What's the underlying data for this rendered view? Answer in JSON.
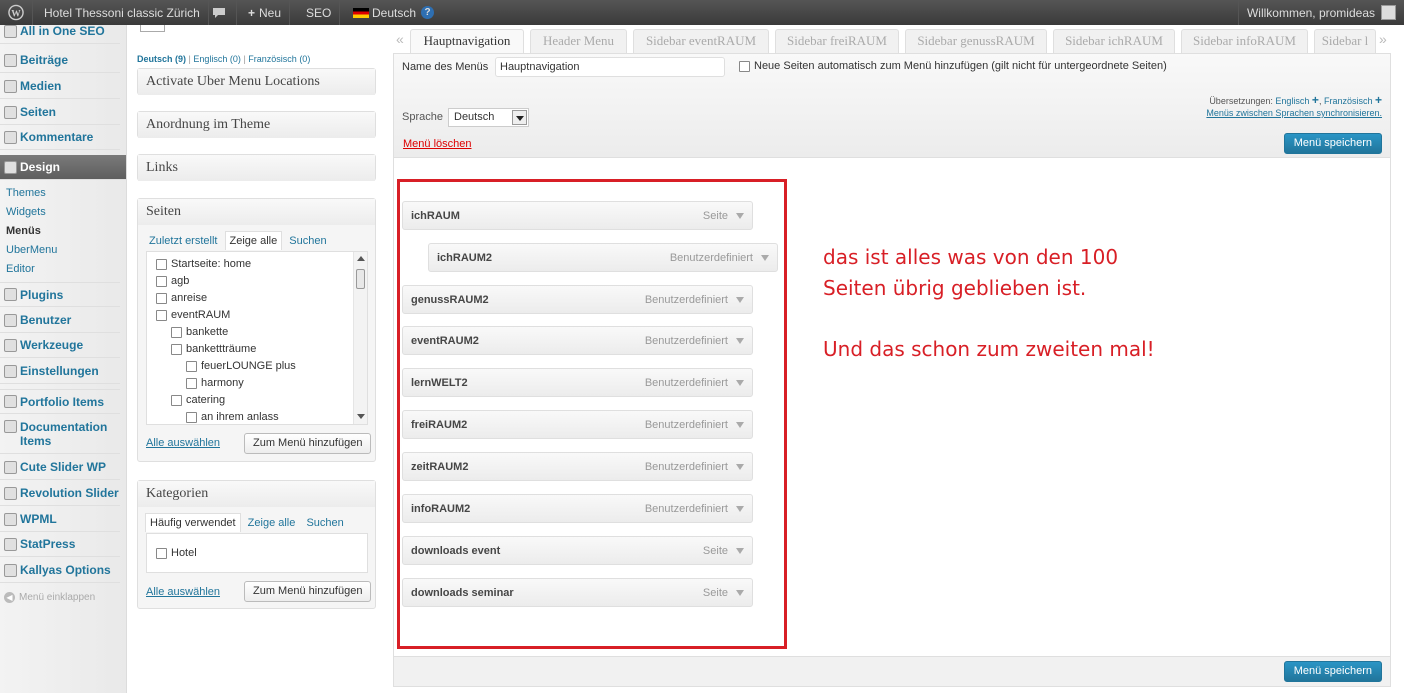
{
  "admin_bar": {
    "site_title": "Hotel Thessoni classic Zürich",
    "new_label": "Neu",
    "seo_label": "SEO",
    "language": "Deutsch",
    "help": "?",
    "welcome": "Willkommen, promideas"
  },
  "sidebar": {
    "items": [
      {
        "label": "All in One SEO"
      },
      {
        "label": "Beiträge"
      },
      {
        "label": "Medien"
      },
      {
        "label": "Seiten"
      },
      {
        "label": "Kommentare"
      },
      {
        "label": "Design"
      },
      {
        "label": "Plugins"
      },
      {
        "label": "Benutzer"
      },
      {
        "label": "Werkzeuge"
      },
      {
        "label": "Einstellungen"
      },
      {
        "label": "Portfolio Items"
      },
      {
        "label": "Documentation Items"
      },
      {
        "label": "Cute Slider WP"
      },
      {
        "label": "Revolution Slider"
      },
      {
        "label": "WPML"
      },
      {
        "label": "StatPress"
      },
      {
        "label": "Kallyas Options"
      }
    ],
    "design_sub": [
      "Themes",
      "Widgets",
      "Menüs",
      "UberMenu",
      "Editor"
    ],
    "collapse": "Menü einklappen"
  },
  "languages": {
    "de": "Deutsch (9)",
    "sep": "|",
    "en": "Englisch (0)",
    "fr": "Französisch (0)"
  },
  "boxes": {
    "uber": "Activate Uber Menu Locations",
    "anordnung": "Anordnung im Theme",
    "links": "Links",
    "seiten": {
      "title": "Seiten",
      "tabs": [
        "Zuletzt erstellt",
        "Zeige alle",
        "Suchen"
      ],
      "items": [
        "Startseite: home",
        "agb",
        "anreise",
        "eventRAUM",
        "bankette",
        "bankettträume",
        "feuerLOUNGE plus",
        "harmony",
        "catering",
        "an ihrem anlass"
      ],
      "select_all": "Alle auswählen",
      "add_button": "Zum Menü hinzufügen"
    },
    "kategorien": {
      "title": "Kategorien",
      "tabs": [
        "Häufig verwendet",
        "Zeige alle",
        "Suchen"
      ],
      "items": [
        "Hotel"
      ],
      "select_all": "Alle auswählen",
      "add_button": "Zum Menü hinzufügen"
    }
  },
  "menu_tabs": [
    "Hauptnavigation",
    "Header Menu",
    "Sidebar eventRAUM",
    "Sidebar freiRAUM",
    "Sidebar genussRAUM",
    "Sidebar ichRAUM",
    "Sidebar infoRAUM",
    "Sidebar l"
  ],
  "menu_editor": {
    "name_label": "Name des Menüs",
    "name_value": "Hauptnavigation",
    "auto_add_label": "Neue Seiten automatisch zum Menü hinzufügen (gilt nicht für untergeordnete Seiten)",
    "language_label": "Sprache",
    "language_value": "Deutsch",
    "translations_label": "Übersetzungen:",
    "translation_en": "Englisch",
    "translation_fr": "Französisch",
    "sync_link": "Menüs zwischen Sprachen synchronisieren.",
    "delete_link": "Menü löschen",
    "save_button": "Menü speichern",
    "items": [
      {
        "title": "ichRAUM",
        "type": "Seite"
      },
      {
        "title": "ichRAUM2",
        "type": "Benutzerdefiniert"
      },
      {
        "title": "genussRAUM2",
        "type": "Benutzerdefiniert"
      },
      {
        "title": "eventRAUM2",
        "type": "Benutzerdefiniert"
      },
      {
        "title": "lernWELT2",
        "type": "Benutzerdefiniert"
      },
      {
        "title": "freiRAUM2",
        "type": "Benutzerdefiniert"
      },
      {
        "title": "zeitRAUM2",
        "type": "Benutzerdefiniert"
      },
      {
        "title": "infoRAUM2",
        "type": "Benutzerdefiniert"
      },
      {
        "title": "downloads event",
        "type": "Seite"
      },
      {
        "title": "downloads seminar",
        "type": "Seite"
      }
    ]
  },
  "annotation": {
    "line1": "das ist alles was von den 100",
    "line2": "Seiten übrig geblieben ist.",
    "line3": "Und das schon zum zweiten mal!"
  }
}
